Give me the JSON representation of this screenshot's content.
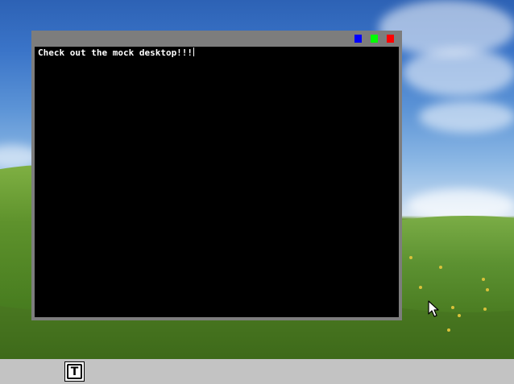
{
  "terminal": {
    "text": "Check out the mock desktop!!!",
    "background": "#000000",
    "foreground": "#ffffff"
  },
  "window": {
    "frame_color": "#7d7d7d",
    "buttons": [
      {
        "name": "minimize",
        "color": "#0000ff"
      },
      {
        "name": "maximize",
        "color": "#00ff00"
      },
      {
        "name": "close",
        "color": "#ff0000"
      }
    ]
  },
  "taskbar": {
    "background": "#c3c3c3",
    "items": [
      {
        "icon": "terminal-icon",
        "glyph": "T"
      }
    ]
  },
  "desktop": {
    "wallpaper": "bliss-hills-blue-sky"
  }
}
